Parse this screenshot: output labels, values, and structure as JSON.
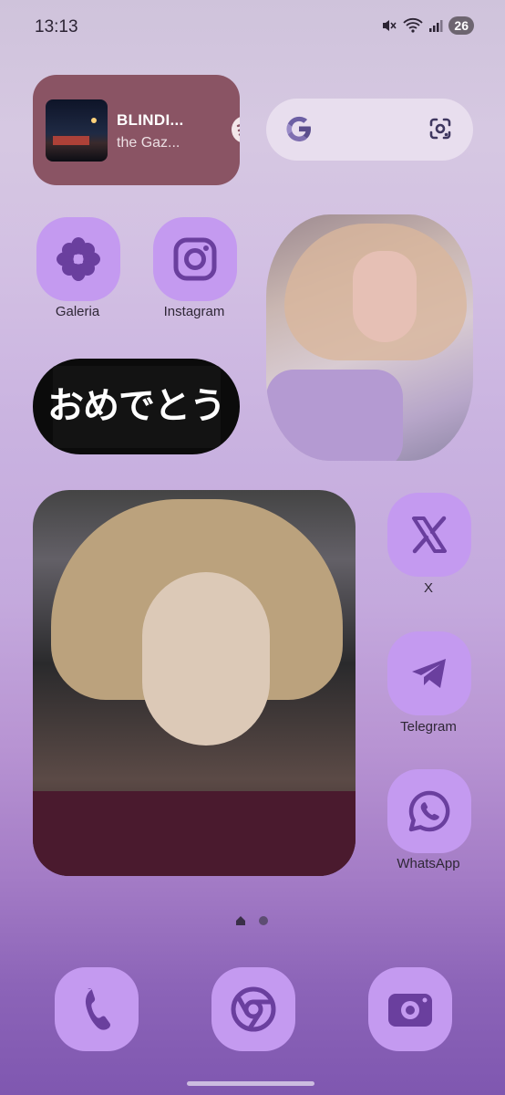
{
  "status_bar": {
    "time": "13:13",
    "battery_level": "26"
  },
  "music_widget": {
    "title": "BLINDI...",
    "artist": "the Gaz...",
    "service_icon": "spotify-icon"
  },
  "search_widget": {
    "logo_icon": "google-g-icon",
    "lens_icon": "google-lens-icon"
  },
  "sticker": {
    "text": "おめでとう"
  },
  "apps": [
    {
      "label": "Galeria",
      "icon": "flower-icon"
    },
    {
      "label": "Instagram",
      "icon": "instagram-icon"
    },
    {
      "label": "X",
      "icon": "x-icon"
    },
    {
      "label": "Telegram",
      "icon": "telegram-icon"
    },
    {
      "label": "WhatsApp",
      "icon": "whatsapp-icon"
    }
  ],
  "dock": [
    {
      "icon": "phone-icon"
    },
    {
      "icon": "chrome-icon"
    },
    {
      "icon": "camera-icon"
    }
  ],
  "colors": {
    "icon_bg": "#c49af0",
    "icon_glyph": "#6a3f9e",
    "music_widget_bg": "#8a5464"
  }
}
